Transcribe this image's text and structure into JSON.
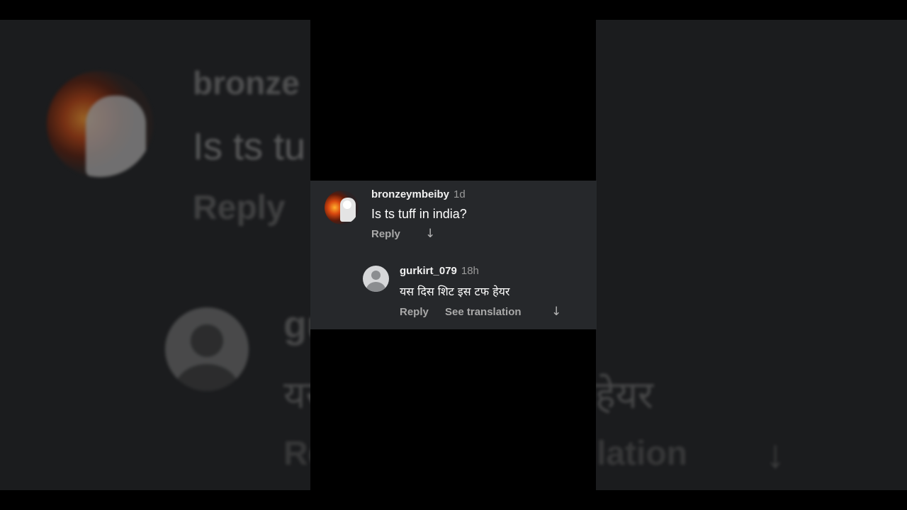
{
  "background": {
    "name_partial": "bronze",
    "comment_partial": "Is ts tu",
    "reply_label": "Reply",
    "reply_name_partial": "gu",
    "reply_text_partial_left": "यस",
    "reply_text_partial_right": "हेयर",
    "reply_action_partial": "Re",
    "translation_partial": "lation",
    "arrow": "↓"
  },
  "comment": {
    "username": "bronzeymbeiby",
    "time": "1d",
    "text": "Is ts tuff in india?",
    "reply_label": "Reply",
    "arrow": "↓"
  },
  "reply": {
    "username": "gurkirt_079",
    "time": "18h",
    "text": "यस दिस शिट इस टफ हेयर",
    "reply_label": "Reply",
    "translate_label": "See translation",
    "arrow": "↓"
  },
  "colors": {
    "card_bg": "#26282b",
    "backdrop": "#1b1c1e",
    "muted_text": "#a9a9a9"
  }
}
